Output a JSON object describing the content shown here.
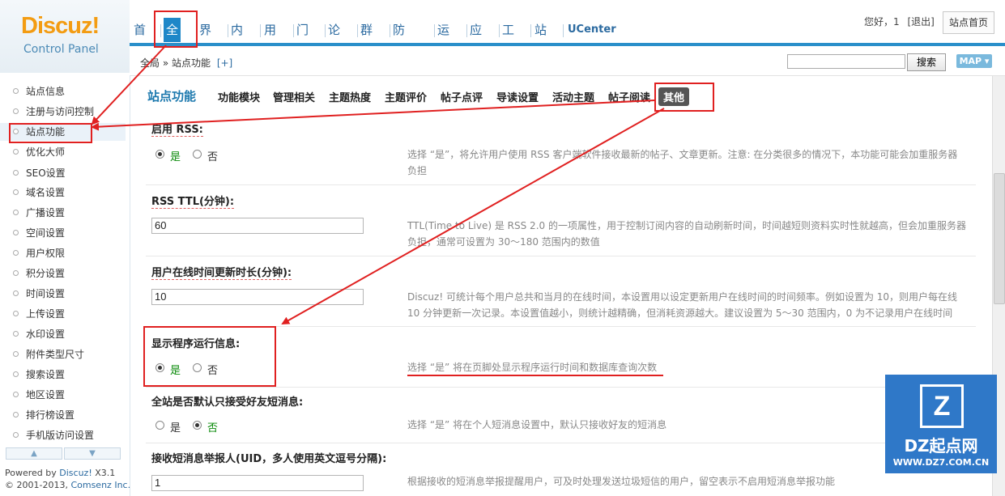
{
  "header": {
    "logo_brand": "Discuz!",
    "logo_sub": "Control Panel",
    "nav": [
      "首页",
      "全局",
      "界面",
      "内容",
      "用户",
      "门户",
      "论坛",
      "群组",
      "防灌水",
      "运营",
      "应用",
      "工具",
      "站长",
      "UCenter"
    ],
    "active_nav": "全局",
    "greeting": "您好，1",
    "logout": "[退出]",
    "home_button": "站点首页"
  },
  "breadcrumb": {
    "path": "全局 » 站点功能",
    "add": "[+]"
  },
  "search": {
    "value": "",
    "button": "搜索",
    "map_button": "MAP ▾"
  },
  "sidebar": {
    "items": [
      "站点信息",
      "注册与访问控制",
      "站点功能",
      "优化大师",
      "SEO设置",
      "域名设置",
      "广播设置",
      "空间设置",
      "用户权限",
      "积分设置",
      "时间设置",
      "上传设置",
      "水印设置",
      "附件类型尺寸",
      "搜索设置",
      "地区设置",
      "排行榜设置",
      "手机版访问设置"
    ],
    "active": "站点功能",
    "powered": "Powered by",
    "powered_brand": "Discuz!",
    "powered_version": "X3.1",
    "copyright": "© 2001-2013,",
    "company": "Comsenz Inc."
  },
  "tabs": {
    "title": "站点功能",
    "items": [
      "功能模块",
      "管理相关",
      "主题热度",
      "主题评价",
      "帖子点评",
      "导读设置",
      "活动主题",
      "帖子阅读",
      "其他"
    ],
    "active": "其他"
  },
  "settings": {
    "rss": {
      "label": "启用 RSS:",
      "yes": "是",
      "no": "否",
      "selected": "是",
      "desc1": "选择 “是”，将允许用户使用 RSS 客户端软件接收最新的帖子、文章更新。注意: 在分类很多的情况下，本功能可能会加重服务器",
      "desc2": "负担"
    },
    "rss_ttl": {
      "label": "RSS TTL(分钟):",
      "value": "60",
      "desc1": "TTL(Time to Live) 是 RSS 2.0 的一项属性，用于控制订阅内容的自动刷新时间，时间越短则资料实时性就越高，但会加重服务器",
      "desc2": "负担，通常可设置为 30～180 范围内的数值"
    },
    "online": {
      "label": "用户在线时间更新时长(分钟):",
      "value": "10",
      "desc1": "Discuz! 可统计每个用户总共和当月的在线时间，本设置用以设定更新用户在线时间的时间频率。例如设置为 10，则用户每在线",
      "desc2": "10 分钟更新一次记录。本设置值越小，则统计越精确，但消耗资源越大。建议设置为 5～30 范围内，0 为不记录用户在线时间"
    },
    "debug": {
      "label": "显示程序运行信息:",
      "yes": "是",
      "no": "否",
      "selected": "是",
      "desc": "选择 “是” 将在页脚处显示程序运行时间和数据库查询次数"
    },
    "friend_pm": {
      "label": "全站是否默认只接受好友短消息:",
      "yes": "是",
      "no": "否",
      "selected": "否",
      "desc": "选择 “是” 将在个人短消息设置中，默认只接收好友的短消息"
    },
    "pm_report": {
      "label": "接收短消息举报人(UID，多人使用英文逗号分隔):",
      "value": "1",
      "desc": "根据接收的短消息举报提醒用户，可及时处理发送垃圾短信的用户，留空表示不启用短消息举报功能"
    }
  },
  "watermark": {
    "logo": "Z",
    "title": "DZ起点网",
    "url": "WWW.DZ7.COM.CN"
  },
  "colors": {
    "accent": "#2a8fca",
    "annotation": "#e02020",
    "active_tab": "#555555"
  }
}
